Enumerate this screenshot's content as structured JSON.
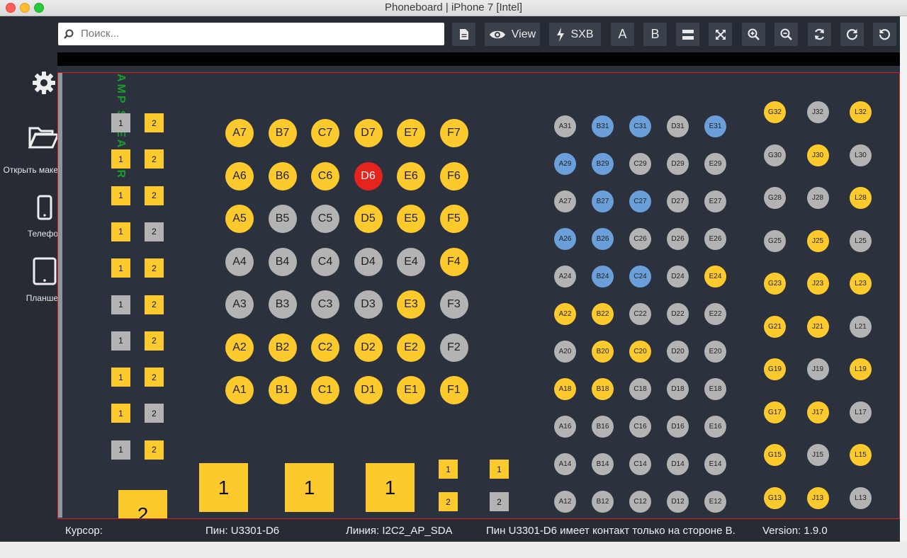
{
  "window": {
    "title": "Phoneboard | iPhone 7 [Intel]"
  },
  "sidebar": {
    "items": [
      {
        "label": "Открыть маке",
        "icon": "folder-open-icon"
      },
      {
        "label": "Телефо",
        "icon": "phone-icon"
      },
      {
        "label": "Планше",
        "icon": "tablet-icon"
      }
    ]
  },
  "toolbar": {
    "search_placeholder": "Поиск...",
    "view_label": "View",
    "sxb_label": "SXB",
    "side_a_label": "A",
    "side_b_label": "B"
  },
  "board": {
    "bga_left": [
      {
        "pins": [
          [
            "A7",
            "y"
          ],
          [
            "B7",
            "y"
          ],
          [
            "C7",
            "y"
          ],
          [
            "D7",
            "y"
          ],
          [
            "E7",
            "y"
          ],
          [
            "F7",
            "y"
          ]
        ]
      },
      {
        "pins": [
          [
            "A6",
            "y"
          ],
          [
            "B6",
            "y"
          ],
          [
            "C6",
            "y"
          ],
          [
            "D6",
            "r"
          ],
          [
            "E6",
            "y"
          ],
          [
            "F6",
            "y"
          ]
        ]
      },
      {
        "pins": [
          [
            "A5",
            "y"
          ],
          [
            "B5",
            "g"
          ],
          [
            "C5",
            "g"
          ],
          [
            "D5",
            "y"
          ],
          [
            "E5",
            "y"
          ],
          [
            "F5",
            "y"
          ]
        ]
      },
      {
        "pins": [
          [
            "A4",
            "g"
          ],
          [
            "B4",
            "g"
          ],
          [
            "C4",
            "g"
          ],
          [
            "D4",
            "g"
          ],
          [
            "E4",
            "g"
          ],
          [
            "F4",
            "y"
          ]
        ]
      },
      {
        "pins": [
          [
            "A3",
            "g"
          ],
          [
            "B3",
            "g"
          ],
          [
            "C3",
            "g"
          ],
          [
            "D3",
            "g"
          ],
          [
            "E3",
            "y"
          ],
          [
            "F3",
            "g"
          ]
        ]
      },
      {
        "pins": [
          [
            "A2",
            "y"
          ],
          [
            "B2",
            "y"
          ],
          [
            "C2",
            "y"
          ],
          [
            "D2",
            "y"
          ],
          [
            "E2",
            "y"
          ],
          [
            "F2",
            "g"
          ]
        ]
      },
      {
        "pins": [
          [
            "A1",
            "y"
          ],
          [
            "B1",
            "y"
          ],
          [
            "C1",
            "y"
          ],
          [
            "D1",
            "y"
          ],
          [
            "E1",
            "y"
          ],
          [
            "F1",
            "y"
          ]
        ]
      }
    ],
    "bga_mid": [
      {
        "pins": [
          [
            "A31",
            "g"
          ],
          [
            "B31",
            "b"
          ],
          [
            "C31",
            "b"
          ],
          [
            "D31",
            "g"
          ],
          [
            "E31",
            "b"
          ]
        ]
      },
      {
        "pins": [
          [
            "A29",
            "b"
          ],
          [
            "B29",
            "b"
          ],
          [
            "C29",
            "g"
          ],
          [
            "D29",
            "g"
          ],
          [
            "E29",
            "g"
          ]
        ]
      },
      {
        "pins": [
          [
            "A27",
            "g"
          ],
          [
            "B27",
            "b"
          ],
          [
            "C27",
            "b"
          ],
          [
            "D27",
            "g"
          ],
          [
            "E27",
            "g"
          ]
        ]
      },
      {
        "pins": [
          [
            "A26",
            "b"
          ],
          [
            "B26",
            "b"
          ],
          [
            "C26",
            "g"
          ],
          [
            "D26",
            "g"
          ],
          [
            "E26",
            "g"
          ]
        ]
      },
      {
        "pins": [
          [
            "A24",
            "g"
          ],
          [
            "B24",
            "b"
          ],
          [
            "C24",
            "b"
          ],
          [
            "D24",
            "g"
          ],
          [
            "E24",
            "y"
          ]
        ]
      },
      {
        "pins": [
          [
            "A22",
            "y"
          ],
          [
            "B22",
            "y"
          ],
          [
            "C22",
            "g"
          ],
          [
            "D22",
            "g"
          ],
          [
            "E22",
            "g"
          ]
        ]
      },
      {
        "pins": [
          [
            "A20",
            "g"
          ],
          [
            "B20",
            "y"
          ],
          [
            "C20",
            "y"
          ],
          [
            "D20",
            "g"
          ],
          [
            "E20",
            "g"
          ]
        ]
      },
      {
        "pins": [
          [
            "A18",
            "y"
          ],
          [
            "B18",
            "y"
          ],
          [
            "C18",
            "g"
          ],
          [
            "D18",
            "g"
          ],
          [
            "E18",
            "g"
          ]
        ]
      },
      {
        "pins": [
          [
            "A16",
            "g"
          ],
          [
            "B16",
            "g"
          ],
          [
            "C16",
            "g"
          ],
          [
            "D16",
            "g"
          ],
          [
            "E16",
            "g"
          ]
        ]
      },
      {
        "pins": [
          [
            "A14",
            "g"
          ],
          [
            "B14",
            "g"
          ],
          [
            "C14",
            "g"
          ],
          [
            "D14",
            "g"
          ],
          [
            "E14",
            "g"
          ]
        ]
      },
      {
        "pins": [
          [
            "A12",
            "g"
          ],
          [
            "B12",
            "g"
          ],
          [
            "C12",
            "g"
          ],
          [
            "D12",
            "g"
          ],
          [
            "E12",
            "g"
          ]
        ]
      }
    ],
    "bga_right": [
      {
        "pins": [
          [
            "G32",
            "y"
          ],
          [
            "J32",
            "g"
          ],
          [
            "L32",
            "y"
          ]
        ]
      },
      {
        "pins": [
          [
            "G30",
            "g"
          ],
          [
            "J30",
            "y"
          ],
          [
            "L30",
            "g"
          ]
        ]
      },
      {
        "pins": [
          [
            "G28",
            "g"
          ],
          [
            "J28",
            "g"
          ],
          [
            "L28",
            "y"
          ]
        ]
      },
      {
        "pins": [
          [
            "G25",
            "g"
          ],
          [
            "J25",
            "y"
          ],
          [
            "L25",
            "g"
          ]
        ]
      },
      {
        "pins": [
          [
            "G23",
            "y"
          ],
          [
            "J23",
            "y"
          ],
          [
            "L23",
            "y"
          ]
        ]
      },
      {
        "pins": [
          [
            "G21",
            "y"
          ],
          [
            "J21",
            "y"
          ],
          [
            "L21",
            "g"
          ]
        ]
      },
      {
        "pins": [
          [
            "G19",
            "y"
          ],
          [
            "J19",
            "g"
          ],
          [
            "L19",
            "y"
          ]
        ]
      },
      {
        "pins": [
          [
            "G17",
            "y"
          ],
          [
            "J17",
            "y"
          ],
          [
            "L17",
            "g"
          ]
        ]
      },
      {
        "pins": [
          [
            "G15",
            "y"
          ],
          [
            "J15",
            "g"
          ],
          [
            "L15",
            "y"
          ]
        ]
      },
      {
        "pins": [
          [
            "G13",
            "y"
          ],
          [
            "J13",
            "y"
          ],
          [
            "L13",
            "g"
          ]
        ]
      }
    ],
    "pads_left": [
      {
        "a": [
          "1",
          "g"
        ],
        "b": [
          "2",
          "y"
        ]
      },
      {
        "a": [
          "1",
          "y"
        ],
        "b": [
          "2",
          "y"
        ]
      },
      {
        "a": [
          "1",
          "y"
        ],
        "b": [
          "2",
          "y"
        ]
      },
      {
        "a": [
          "1",
          "y"
        ],
        "b": [
          "2",
          "g"
        ]
      },
      {
        "a": [
          "1",
          "y"
        ],
        "b": [
          "2",
          "y"
        ]
      },
      {
        "a": [
          "1",
          "g"
        ],
        "b": [
          "2",
          "y"
        ]
      },
      {
        "a": [
          "1",
          "g"
        ],
        "b": [
          "2",
          "y"
        ]
      },
      {
        "a": [
          "1",
          "y"
        ],
        "b": [
          "2",
          "y"
        ]
      },
      {
        "a": [
          "1",
          "y"
        ],
        "b": [
          "2",
          "g"
        ]
      },
      {
        "a": [
          "1",
          "g"
        ],
        "b": [
          "2",
          "y"
        ]
      }
    ],
    "pads_bottom_large": [
      "1",
      "1",
      "1"
    ],
    "pad_bottom_two": "2",
    "pads_small_bottom": [
      {
        "a": [
          "1",
          "y"
        ],
        "b": [
          "2",
          "y"
        ]
      },
      {
        "a": [
          "1",
          "y"
        ],
        "b": [
          "2",
          "g"
        ]
      }
    ]
  },
  "status": {
    "cursor": "Курсор:",
    "pin": "Пин: U3301-D6",
    "net": "Линия: I2C2_AP_SDA",
    "message": "Пин U3301-D6 имеет контакт только на стороне B.",
    "version": "Version: 1.9.0"
  }
}
